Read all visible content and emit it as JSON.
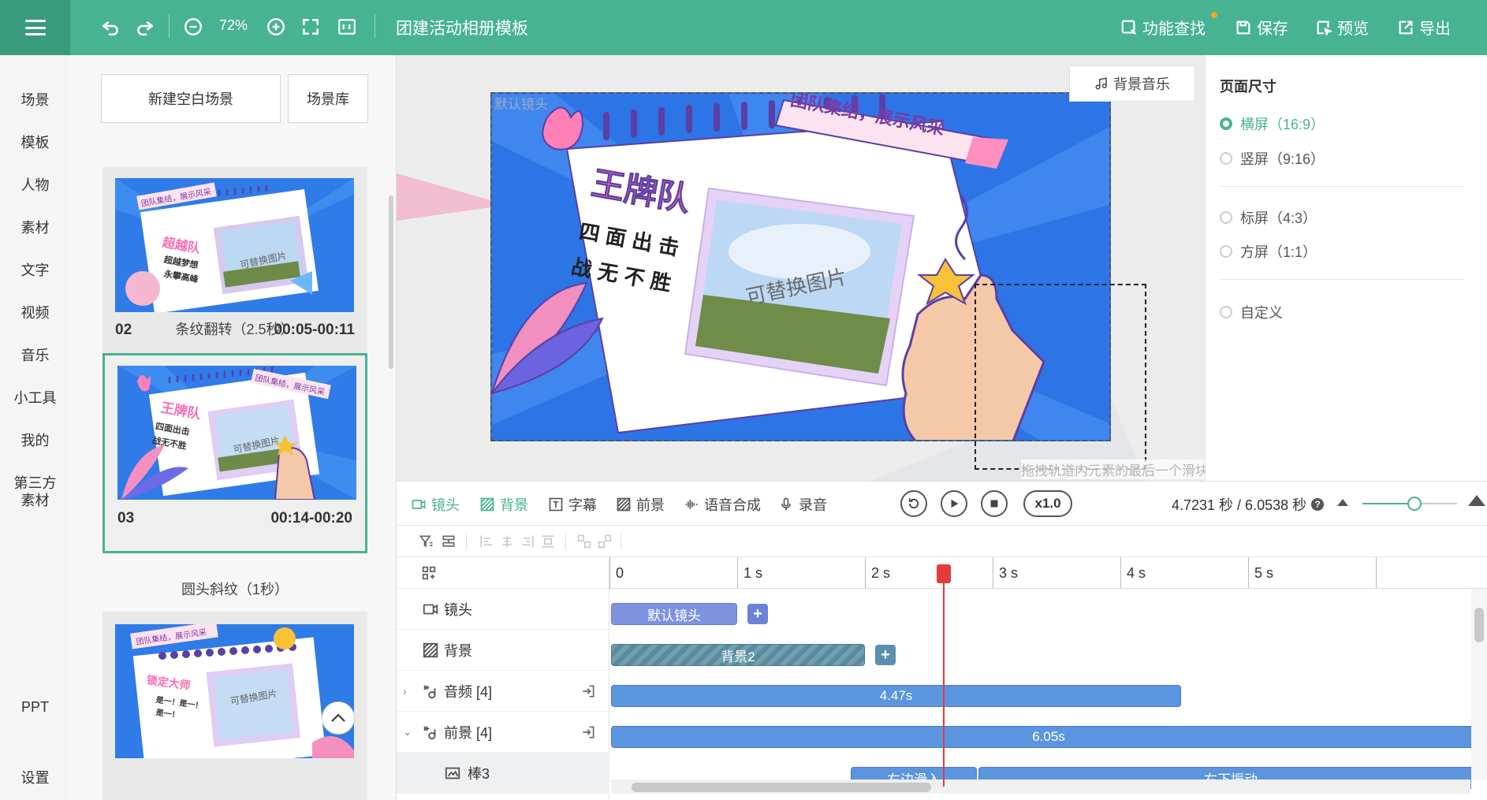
{
  "topbar": {
    "zoom": "72%",
    "title": "团建活动相册模板",
    "actions": {
      "search": "功能查找",
      "save": "保存",
      "preview": "预览",
      "export": "导出"
    }
  },
  "leftnav": {
    "items": [
      "场景",
      "模板",
      "人物",
      "素材",
      "文字",
      "视频",
      "音乐",
      "小工具",
      "我的",
      "第三方",
      "素材",
      "PPT",
      "设置"
    ]
  },
  "scenes": {
    "new_blank": "新建空白场景",
    "library": "场景库",
    "cards": [
      {
        "num": "02",
        "time": "00:05-00:11",
        "transition": "条纹翻转（2.5秒）",
        "title_text": "超越队",
        "line1": "超越梦想",
        "line2": "永攀高峰"
      },
      {
        "num": "03",
        "time": "00:14-00:20",
        "transition": "圆头斜纹（1秒）",
        "title_text": "王牌队",
        "line1": "四面出击",
        "line2": "战无不胜"
      },
      {
        "title_text": "锁定大师",
        "line1": "是一！是一！",
        "line2": "是一！"
      }
    ],
    "banner": "团队集结，展示风采",
    "photo_placeholder": "可替换图片"
  },
  "canvas": {
    "camera_label": "默认镜头",
    "bgm": "背景音乐",
    "banner": "团队集结，展示风采",
    "team_name": "王牌队",
    "slogan_line1": "四面出击",
    "slogan_line2": "战无不胜",
    "photo_placeholder": "可替换图片",
    "hint": "拖拽轨道内元素的最后一个滑块或刻度尺末端滑块可增加或减少总时间"
  },
  "props": {
    "title": "页面尺寸",
    "options": [
      "横屏（16:9）",
      "竖屏（9:16）",
      "标屏（4:3）",
      "方屏（1:1）",
      "自定义"
    ],
    "selected": "横屏（16:9）"
  },
  "timeline": {
    "tabs": [
      "镜头",
      "背景",
      "字幕",
      "前景",
      "语音合成",
      "录音"
    ],
    "active_tab": "背景",
    "speed": "x1.0",
    "time_readout": "4.7231 秒 / 6.0538 秒",
    "zoom_level": 0.55,
    "ruler": [
      "0",
      "1 s",
      "2 s",
      "3 s",
      "4 s",
      "5 s"
    ],
    "tracks": [
      {
        "label": "镜头",
        "clip": "默认镜头"
      },
      {
        "label": "背景",
        "clip": "背景2"
      },
      {
        "label": "音频 [4]",
        "clip": "4.47s"
      },
      {
        "label": "前景 [4]",
        "clip": "6.05s"
      },
      {
        "label": "棒3",
        "clips": [
          "右边滑入",
          "右下振动"
        ]
      }
    ]
  }
}
